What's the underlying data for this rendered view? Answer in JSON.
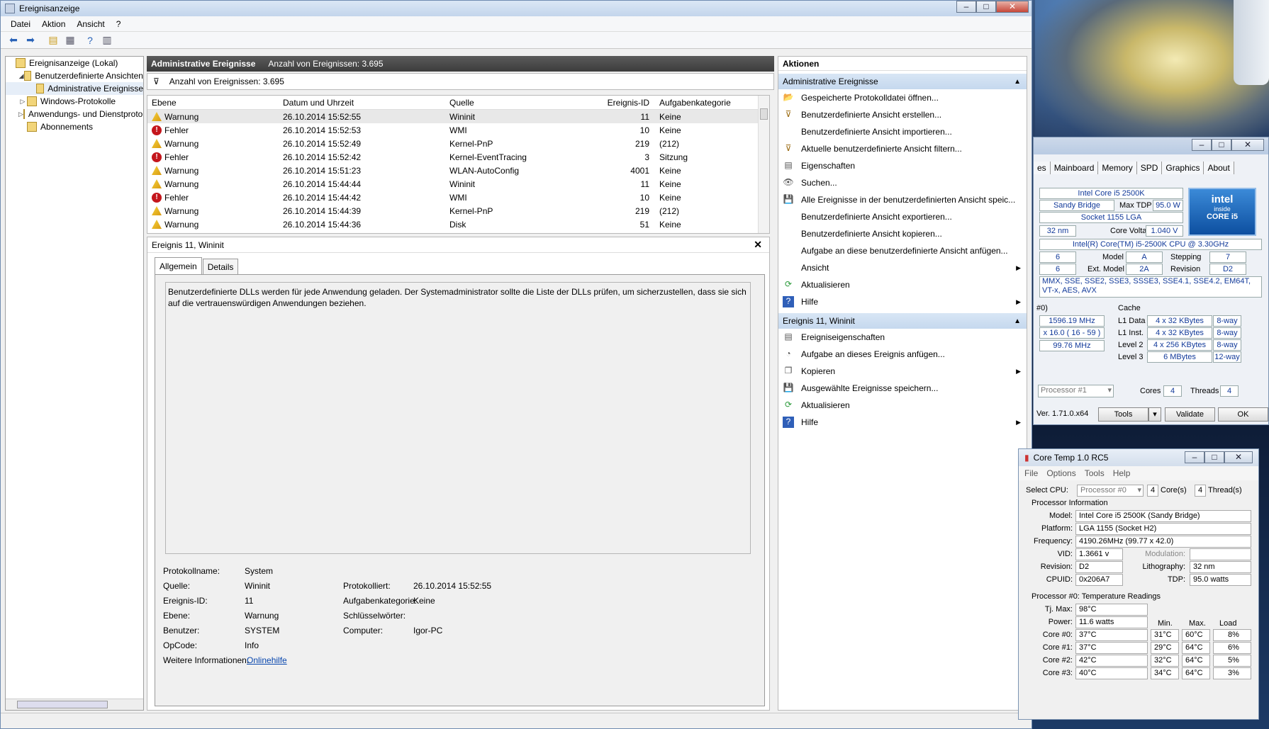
{
  "window": {
    "title": "Ereignisanzeige",
    "menu": [
      "Datei",
      "Aktion",
      "Ansicht",
      "?"
    ]
  },
  "tree": {
    "items": [
      {
        "label": "Ereignisanzeige (Lokal)",
        "indent": 0,
        "arrow": ""
      },
      {
        "label": "Benutzerdefinierte Ansichten",
        "indent": 1,
        "arrow": "◢"
      },
      {
        "label": "Administrative Ereignisse",
        "indent": 2,
        "arrow": ""
      },
      {
        "label": "Windows-Protokolle",
        "indent": 1,
        "arrow": "▷"
      },
      {
        "label": "Anwendungs- und Dienstprotokolle",
        "indent": 1,
        "arrow": "▷"
      },
      {
        "label": "Abonnements",
        "indent": 1,
        "arrow": ""
      }
    ]
  },
  "center": {
    "header_title": "Administrative Ereignisse",
    "header_count": "Anzahl von Ereignissen: 3.695",
    "filter_text": "Anzahl von Ereignissen: 3.695",
    "columns": [
      "Ebene",
      "Datum und Uhrzeit",
      "Quelle",
      "Ereignis-ID",
      "Aufgabenkategorie"
    ],
    "rows": [
      {
        "level": "Warnung",
        "type": "warn",
        "date": "26.10.2014 15:52:55",
        "source": "Wininit",
        "id": "11",
        "cat": "Keine"
      },
      {
        "level": "Fehler",
        "type": "err",
        "date": "26.10.2014 15:52:53",
        "source": "WMI",
        "id": "10",
        "cat": "Keine"
      },
      {
        "level": "Warnung",
        "type": "warn",
        "date": "26.10.2014 15:52:49",
        "source": "Kernel-PnP",
        "id": "219",
        "cat": "(212)"
      },
      {
        "level": "Fehler",
        "type": "err",
        "date": "26.10.2014 15:52:42",
        "source": "Kernel-EventTracing",
        "id": "3",
        "cat": "Sitzung"
      },
      {
        "level": "Warnung",
        "type": "warn",
        "date": "26.10.2014 15:51:23",
        "source": "WLAN-AutoConfig",
        "id": "4001",
        "cat": "Keine"
      },
      {
        "level": "Warnung",
        "type": "warn",
        "date": "26.10.2014 15:44:44",
        "source": "Wininit",
        "id": "11",
        "cat": "Keine"
      },
      {
        "level": "Fehler",
        "type": "err",
        "date": "26.10.2014 15:44:42",
        "source": "WMI",
        "id": "10",
        "cat": "Keine"
      },
      {
        "level": "Warnung",
        "type": "warn",
        "date": "26.10.2014 15:44:39",
        "source": "Kernel-PnP",
        "id": "219",
        "cat": "(212)"
      },
      {
        "level": "Warnung",
        "type": "warn",
        "date": "26.10.2014 15:44:36",
        "source": "Disk",
        "id": "51",
        "cat": "Keine"
      }
    ],
    "detail": {
      "title": "Ereignis 11, Wininit",
      "tabs": [
        "Allgemein",
        "Details"
      ],
      "message": "Benutzerdefinierte DLLs werden für jede Anwendung geladen. Der Systemadministrator sollte die Liste der DLLs prüfen, um sicherzustellen, dass sie sich auf die vertrauenswürdigen Anwendungen beziehen.",
      "props": {
        "protokollname_l": "Protokollname:",
        "protokollname": "System",
        "quelle_l": "Quelle:",
        "quelle": "Wininit",
        "protokolliert_l": "Protokolliert:",
        "protokolliert": "26.10.2014 15:52:55",
        "id_l": "Ereignis-ID:",
        "id": "11",
        "kat_l": "Aufgabenkategorie:",
        "kat": "Keine",
        "ebene_l": "Ebene:",
        "ebene": "Warnung",
        "schl_l": "Schlüsselwörter:",
        "benutzer_l": "Benutzer:",
        "benutzer": "SYSTEM",
        "computer_l": "Computer:",
        "computer": "Igor-PC",
        "opcode_l": "OpCode:",
        "opcode": "Info",
        "info_l": "Weitere Informationen:",
        "info": "Onlinehilfe"
      }
    }
  },
  "actions": {
    "title": "Aktionen",
    "section1": "Administrative Ereignisse",
    "items1": [
      {
        "label": "Gespeicherte Protokolldatei öffnen...",
        "icon": "folder-icon",
        "sub": false
      },
      {
        "label": "Benutzerdefinierte Ansicht erstellen...",
        "icon": "filter-icon",
        "sub": false
      },
      {
        "label": "Benutzerdefinierte Ansicht importieren...",
        "icon": "",
        "sub": false
      },
      {
        "label": "Aktuelle benutzerdefinierte Ansicht filtern...",
        "icon": "filter-icon",
        "sub": false
      },
      {
        "label": "Eigenschaften",
        "icon": "properties-icon",
        "sub": false
      },
      {
        "label": "Suchen...",
        "icon": "binoculars-icon",
        "sub": false
      },
      {
        "label": "Alle Ereignisse in der benutzerdefinierten Ansicht speic...",
        "icon": "save-icon",
        "sub": false
      },
      {
        "label": "Benutzerdefinierte Ansicht exportieren...",
        "icon": "",
        "sub": false
      },
      {
        "label": "Benutzerdefinierte Ansicht kopieren...",
        "icon": "",
        "sub": false
      },
      {
        "label": "Aufgabe an diese benutzerdefinierte Ansicht anfügen...",
        "icon": "",
        "sub": false
      },
      {
        "label": "Ansicht",
        "icon": "",
        "sub": true
      },
      {
        "label": "Aktualisieren",
        "icon": "refresh-icon",
        "sub": false
      },
      {
        "label": "Hilfe",
        "icon": "help-icon",
        "sub": true
      }
    ],
    "section2": "Ereignis 11, Wininit",
    "items2": [
      {
        "label": "Ereigniseigenschaften",
        "icon": "properties-icon",
        "sub": false
      },
      {
        "label": "Aufgabe an dieses Ereignis anfügen...",
        "icon": "task-icon",
        "sub": false
      },
      {
        "label": "Kopieren",
        "icon": "copy-icon",
        "sub": true
      },
      {
        "label": "Ausgewählte Ereignisse speichern...",
        "icon": "save-icon",
        "sub": false
      },
      {
        "label": "Aktualisieren",
        "icon": "refresh-icon",
        "sub": false
      },
      {
        "label": "Hilfe",
        "icon": "help-icon",
        "sub": true
      }
    ]
  },
  "cpuz": {
    "tabs": [
      "es",
      "Mainboard",
      "Memory",
      "SPD",
      "Graphics",
      "About"
    ],
    "name": "Intel Core i5 2500K",
    "codename": "Sandy Bridge",
    "maxtdp_l": "Max TDP",
    "maxtdp": "95.0 W",
    "package": "Socket 1155 LGA",
    "tech": "32 nm",
    "voltage_l": "Core Voltage",
    "voltage": "1.040 V",
    "spec": "Intel(R) Core(TM) i5-2500K CPU @ 3.30GHz",
    "family": "6",
    "model_l": "Model",
    "model": "A",
    "stepping_l": "Stepping",
    "stepping": "7",
    "extfamily": "6",
    "extmodel_l": "Ext. Model",
    "extmodel": "2A",
    "revision_l": "Revision",
    "revision": "D2",
    "instr": "MMX, SSE, SSE2, SSE3, SSSE3, SSE4.1, SSE4.2, EM64T, VT-x, AES, AVX",
    "clocks_l": "#0)",
    "cache_l": "Cache",
    "core_speed": "1596.19 MHz",
    "multiplier": "x 16.0 ( 16 - 59 )",
    "bus": "99.76 MHz",
    "l1d_l": "L1 Data",
    "l1d": "4 x 32 KBytes",
    "l1d_w": "8-way",
    "l1i_l": "L1 Inst.",
    "l1i": "4 x 32 KBytes",
    "l1i_w": "8-way",
    "l2_l": "Level 2",
    "l2": "4 x 256 KBytes",
    "l2_w": "8-way",
    "l3_l": "Level 3",
    "l3": "6 MBytes",
    "l3_w": "12-way",
    "selection": "Processor #1",
    "cores_l": "Cores",
    "cores": "4",
    "threads_l": "Threads",
    "threads": "4",
    "version": "Ver. 1.71.0.x64",
    "tools": "Tools",
    "validate": "Validate",
    "ok": "OK",
    "logo_brand": "intel",
    "logo_inside": "inside",
    "logo_core": "CORE i5"
  },
  "coretemp": {
    "title": "Core Temp 1.0 RC5",
    "menu": [
      "File",
      "Options",
      "Tools",
      "Help"
    ],
    "selectcpu_l": "Select CPU:",
    "selectcpu": "Processor #0",
    "cores": "4",
    "cores_l": "Core(s)",
    "threads": "4",
    "threads_l": "Thread(s)",
    "procinfo_l": "Processor Information",
    "model_l": "Model:",
    "model": "Intel Core i5 2500K (Sandy Bridge)",
    "platform_l": "Platform:",
    "platform": "LGA 1155 (Socket H2)",
    "freq_l": "Frequency:",
    "freq": "4190.26MHz (99.77 x 42.0)",
    "vid_l": "VID:",
    "vid": "1.3661 v",
    "mod_l": "Modulation:",
    "rev_l": "Revision:",
    "rev": "D2",
    "litho_l": "Lithography:",
    "litho": "32 nm",
    "cpuid_l": "CPUID:",
    "cpuid": "0x206A7",
    "tdp_l": "TDP:",
    "tdp": "95.0 watts",
    "temps_l": "Processor #0: Temperature Readings",
    "tjmax_l": "Tj. Max:",
    "tjmax": "98°C",
    "power_l": "Power:",
    "power": "11.6 watts",
    "min_l": "Min.",
    "max_l": "Max.",
    "load_l": "Load",
    "cores_list": [
      {
        "label": "Core #0:",
        "temp": "37°C",
        "min": "31°C",
        "max": "60°C",
        "load": "8%"
      },
      {
        "label": "Core #1:",
        "temp": "37°C",
        "min": "29°C",
        "max": "64°C",
        "load": "6%"
      },
      {
        "label": "Core #2:",
        "temp": "42°C",
        "min": "32°C",
        "max": "64°C",
        "load": "5%"
      },
      {
        "label": "Core #3:",
        "temp": "40°C",
        "min": "34°C",
        "max": "64°C",
        "load": "3%"
      }
    ]
  }
}
